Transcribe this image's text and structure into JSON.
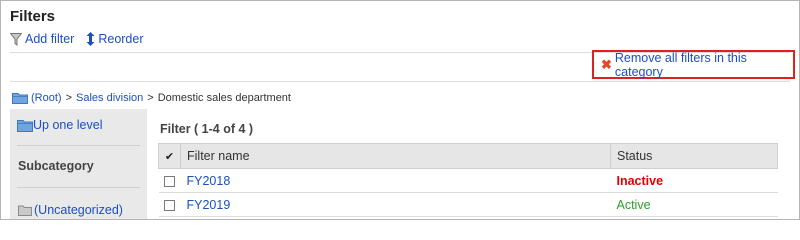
{
  "page": {
    "title": "Filters"
  },
  "toolbar": {
    "add_filter": "Add filter",
    "reorder": "Reorder"
  },
  "remove_all": {
    "label": "Remove all filters in this category",
    "highlight_color": "#e02020"
  },
  "breadcrumb": {
    "root": "(Root)",
    "sep1": ">",
    "division": "Sales division",
    "sep2": ">",
    "current": "Domestic sales department"
  },
  "sidebar": {
    "up_one_level": "Up one level",
    "subcategory": "Subcategory",
    "uncategorized": "(Uncategorized)"
  },
  "list": {
    "count_label": "Filter ( 1-4 of 4 )",
    "header": {
      "check": "✔",
      "name": "Filter name",
      "status": "Status"
    },
    "rows": [
      {
        "name": "FY2018",
        "status": "Inactive"
      },
      {
        "name": "FY2019",
        "status": "Active"
      }
    ]
  },
  "colors": {
    "link": "#1b4fc2",
    "inactive": "#e00000",
    "active": "#2aa02a"
  },
  "icons": {
    "add_filter": "funnel-icon",
    "reorder": "updown-arrow-icon",
    "remove": "red-x-icon",
    "folder": "folder-icon"
  }
}
